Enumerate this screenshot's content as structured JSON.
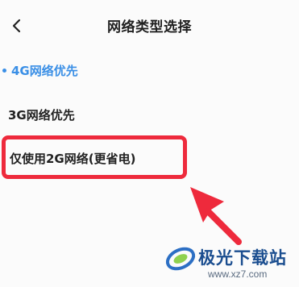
{
  "header": {
    "back_icon": "chevron-left-icon",
    "title": "网络类型选择"
  },
  "options": [
    {
      "label": "4G网络优先",
      "selected": true,
      "color": "#3a8fe6"
    },
    {
      "label": "3G网络优先",
      "selected": false
    },
    {
      "label": "仅使用2G网络(更省电)",
      "selected": false,
      "highlighted": true
    }
  ],
  "annotation": {
    "highlight_color": "#ee2a3c",
    "arrow_color": "#ee2a3c"
  },
  "watermark": {
    "text": "极光下载站",
    "url": "www.xz7.com"
  }
}
